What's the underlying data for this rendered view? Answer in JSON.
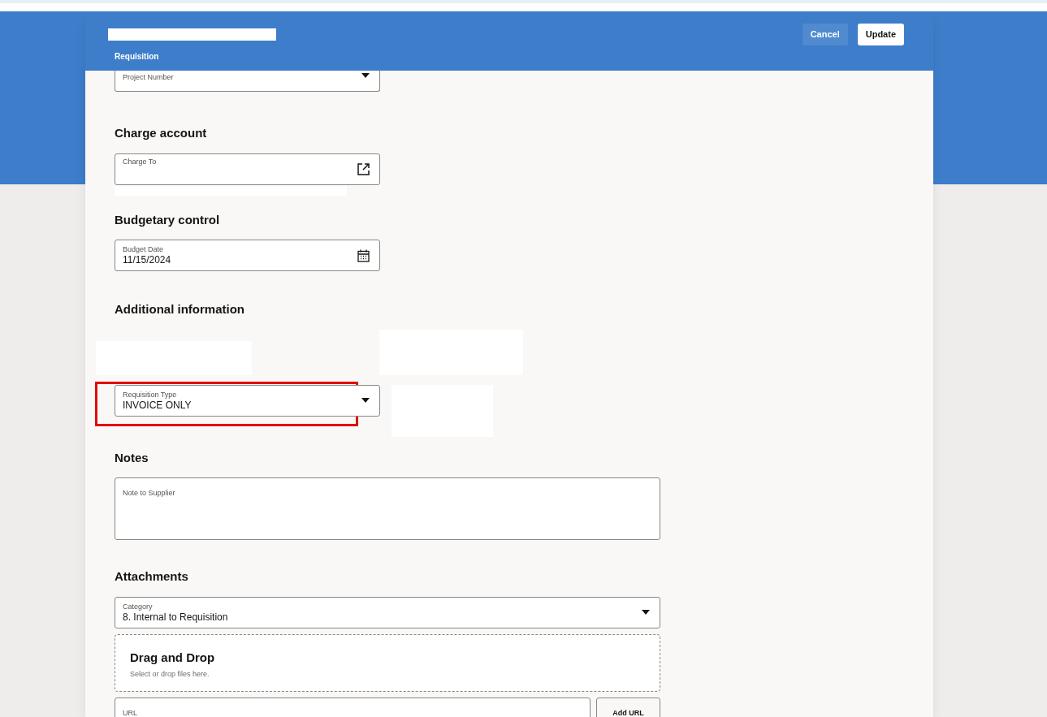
{
  "header": {
    "subtitle": "Requisition",
    "buttons": [
      {
        "label": "Cancel",
        "kind": "secondary"
      },
      {
        "label": "Update",
        "kind": "primary"
      }
    ]
  },
  "sections": [
    {
      "fields": [
        {
          "kind": "select",
          "label": "Project Number"
        }
      ]
    },
    {
      "heading": "Charge account",
      "fields": [
        {
          "kind": "link",
          "label": "Charge To"
        }
      ]
    },
    {
      "heading": "Budgetary control",
      "fields": [
        {
          "kind": "date",
          "label": "Budget Date",
          "value": "11/15/2024"
        }
      ]
    },
    {
      "heading": "Additional information",
      "fields": [
        {
          "kind": "select",
          "label": "Requisition Type",
          "value": "INVOICE ONLY",
          "highlighted": true
        }
      ]
    },
    {
      "heading": "Notes",
      "fields": [
        {
          "kind": "textarea",
          "label": "Note to Supplier"
        }
      ]
    },
    {
      "heading": "Attachments",
      "fields": [
        {
          "kind": "select",
          "label": "Category",
          "value": "8. Internal to Requisition"
        },
        {
          "kind": "dropzone",
          "label": "Drag and Drop",
          "hint": "Select or drop files here."
        },
        {
          "kind": "url",
          "label": "URL",
          "button": "Add URL"
        }
      ]
    }
  ]
}
